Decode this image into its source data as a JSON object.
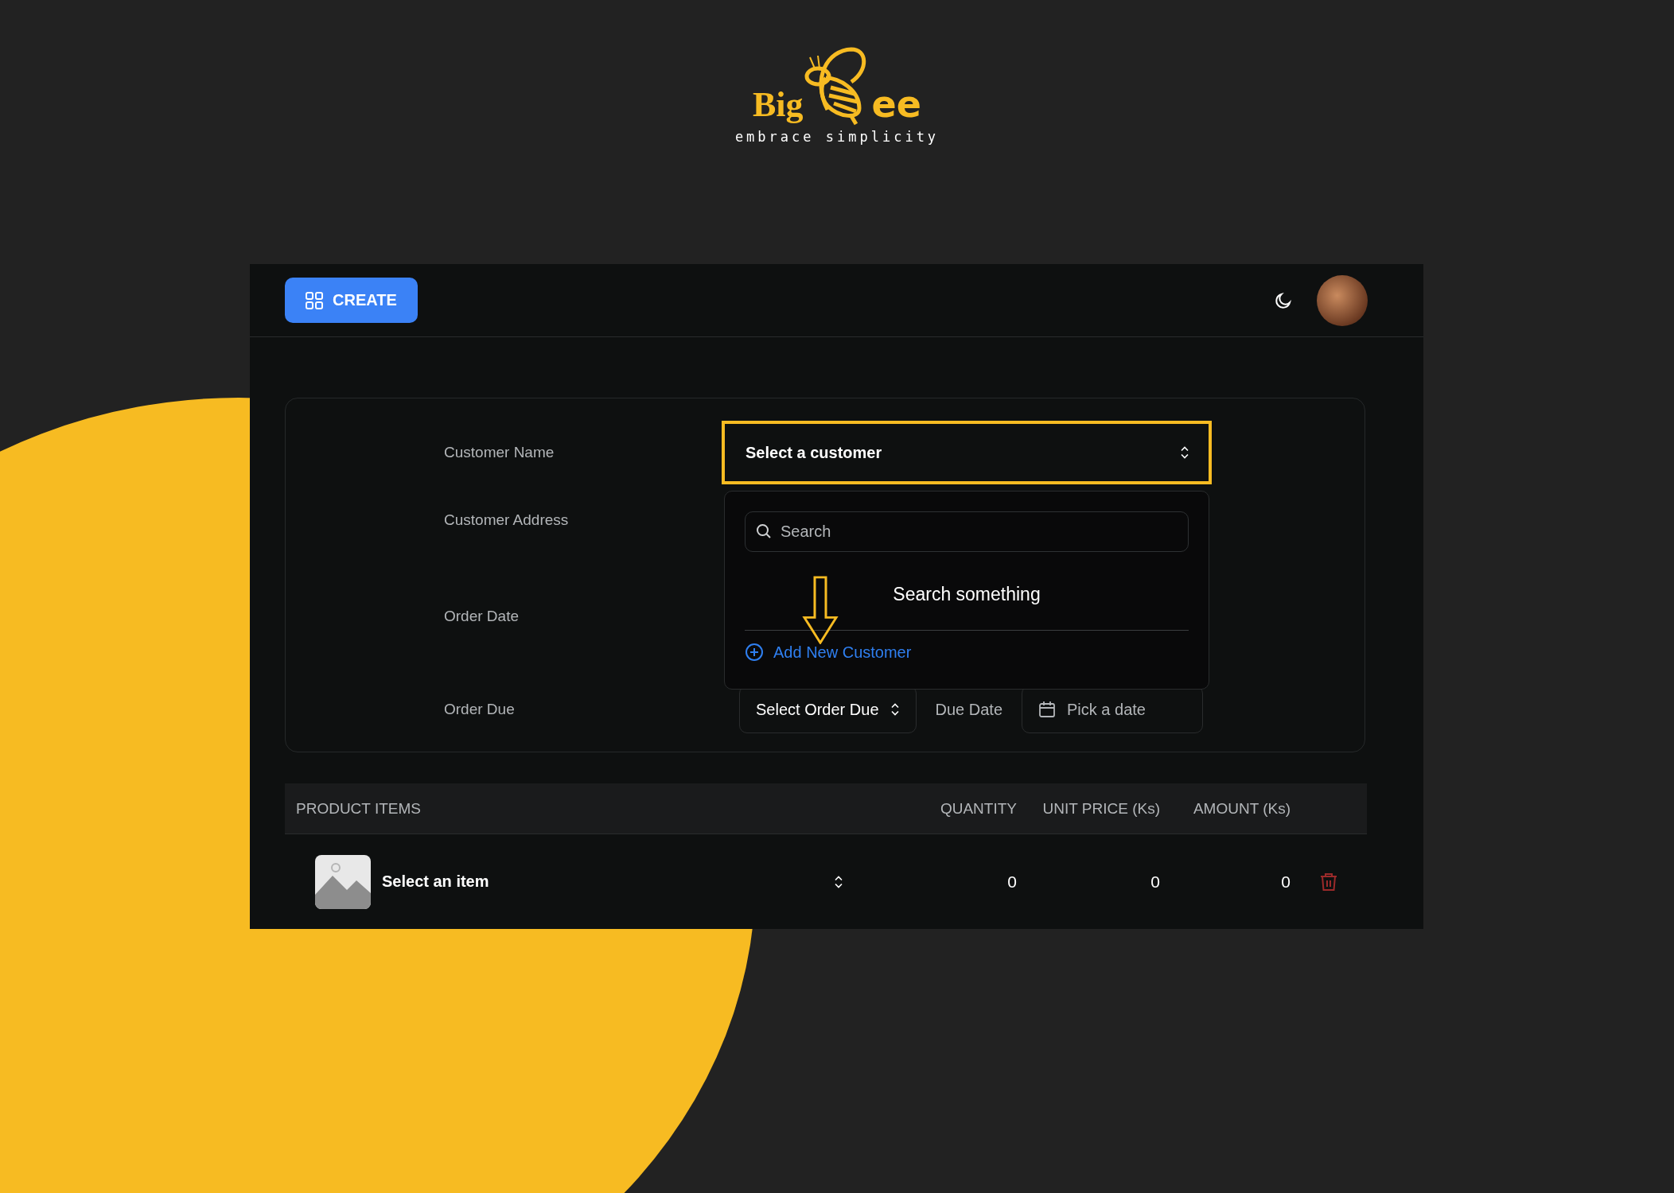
{
  "logo": {
    "brand_left": "Big",
    "brand_right": "ee",
    "tagline": "embrace simplicity"
  },
  "header": {
    "create_button": "CREATE"
  },
  "form": {
    "fields": [
      {
        "label": "Customer Name"
      },
      {
        "label": "Customer Address"
      },
      {
        "label": "Order Date"
      },
      {
        "label": "Order Due"
      }
    ],
    "customer_select": {
      "value": "Select a customer",
      "highlighted": true
    },
    "customer_dropdown": {
      "search_placeholder": "Search",
      "empty_text": "Search something",
      "add_link": "Add New Customer"
    },
    "order_due": {
      "select": "Select Order Due",
      "label": "Due Date",
      "date_placeholder": "Pick a date"
    }
  },
  "table": {
    "columns": [
      "PRODUCT ITEMS",
      "QUANTITY",
      "UNIT PRICE (Ks)",
      "AMOUNT (Ks)"
    ],
    "rows": [
      {
        "item": "Select an item",
        "quantity": "0",
        "unit_price": "0",
        "amount": "0"
      }
    ]
  }
}
